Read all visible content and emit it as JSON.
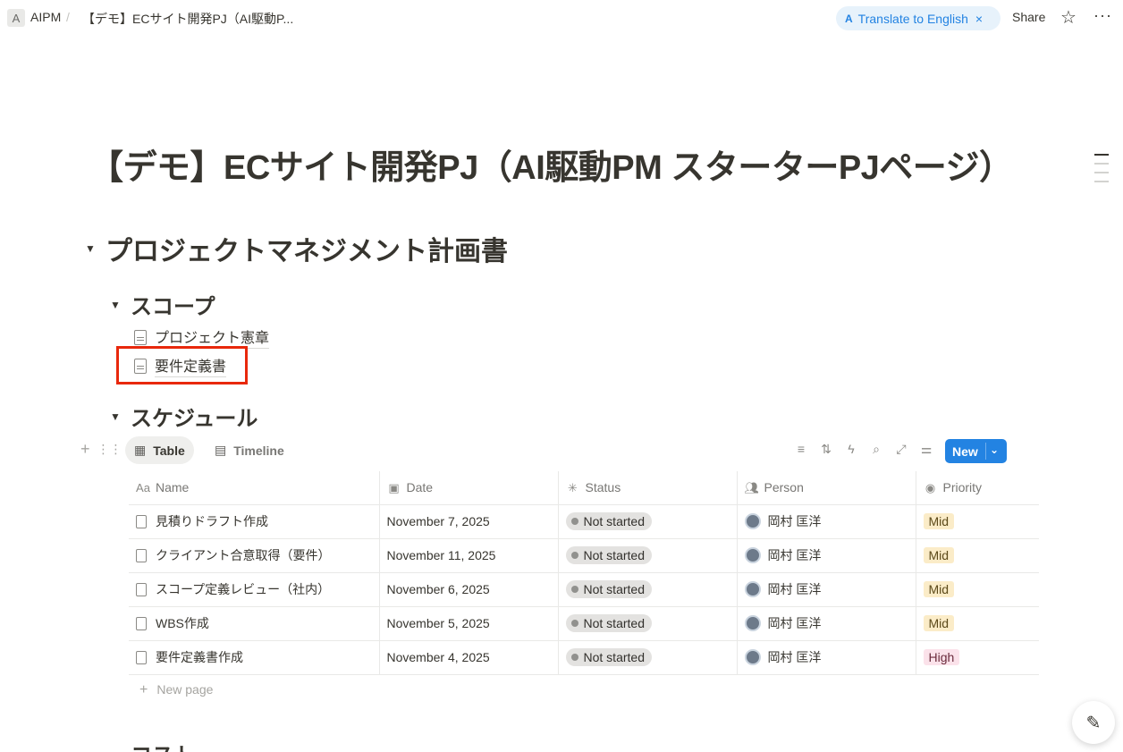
{
  "topbar": {
    "workspace_initial": "A",
    "breadcrumb": [
      "AIPM",
      "【デモ】ECサイト開発PJ（AI駆動P..."
    ],
    "breadcrumb_separator": "/",
    "translate_label": "Translate to English",
    "translate_icon": "translate-icon",
    "translate_close": "×",
    "share_label": "Share",
    "favorite_icon": "☆",
    "more_icon": "···"
  },
  "page": {
    "title": "【デモ】ECサイト開発PJ（AI駆動PM スターターPJページ）"
  },
  "sections": {
    "pm_plan": {
      "toggle": "▼",
      "title": "プロジェクトマネジメント計画書"
    },
    "scope": {
      "toggle": "▼",
      "title": "スコープ",
      "links": [
        "プロジェクト憲章",
        "要件定義書"
      ]
    },
    "schedule": {
      "toggle": "▼",
      "title": "スケジュール"
    },
    "cost_partial": "コスト"
  },
  "database": {
    "views": [
      {
        "label": "Table",
        "icon": "table-icon"
      },
      {
        "label": "Timeline",
        "icon": "timeline-icon"
      }
    ],
    "actions": [
      "filter-icon",
      "sort-icon",
      "automation-icon",
      "search-icon",
      "expand-icon",
      "settings-icon"
    ],
    "new_button": "New",
    "columns": [
      {
        "label": "Name",
        "icon": "Aa"
      },
      {
        "label": "Date",
        "icon": "calendar-icon"
      },
      {
        "label": "Status",
        "icon": "status-icon"
      },
      {
        "label": "Person",
        "icon": "people-icon"
      },
      {
        "label": "Priority",
        "icon": "select-icon"
      }
    ],
    "rows": [
      {
        "name": "見積りドラフト作成",
        "date": "November 7, 2025",
        "status": "Not started",
        "person": "岡村 匡洋",
        "priority": "Mid"
      },
      {
        "name": "クライアント合意取得（要件）",
        "date": "November 11, 2025",
        "status": "Not started",
        "person": "岡村 匡洋",
        "priority": "Mid"
      },
      {
        "name": "スコープ定義レビュー（社内）",
        "date": "November 6, 2025",
        "status": "Not started",
        "person": "岡村 匡洋",
        "priority": "Mid"
      },
      {
        "name": "WBS作成",
        "date": "November 5, 2025",
        "status": "Not started",
        "person": "岡村 匡洋",
        "priority": "Mid"
      },
      {
        "name": "要件定義書作成",
        "date": "November 4, 2025",
        "status": "Not started",
        "person": "岡村 匡洋",
        "priority": "High"
      }
    ],
    "new_page_label": "New page",
    "priority_colors": {
      "Mid": {
        "bg": "#fbecc8",
        "fg": "#5c4a1a"
      },
      "High": {
        "bg": "#fbe2ea",
        "fg": "#6a2b3c"
      }
    },
    "accent_color": "#2383e2"
  },
  "highlight": {
    "target": "要件定義書",
    "color": "#e8280c"
  }
}
